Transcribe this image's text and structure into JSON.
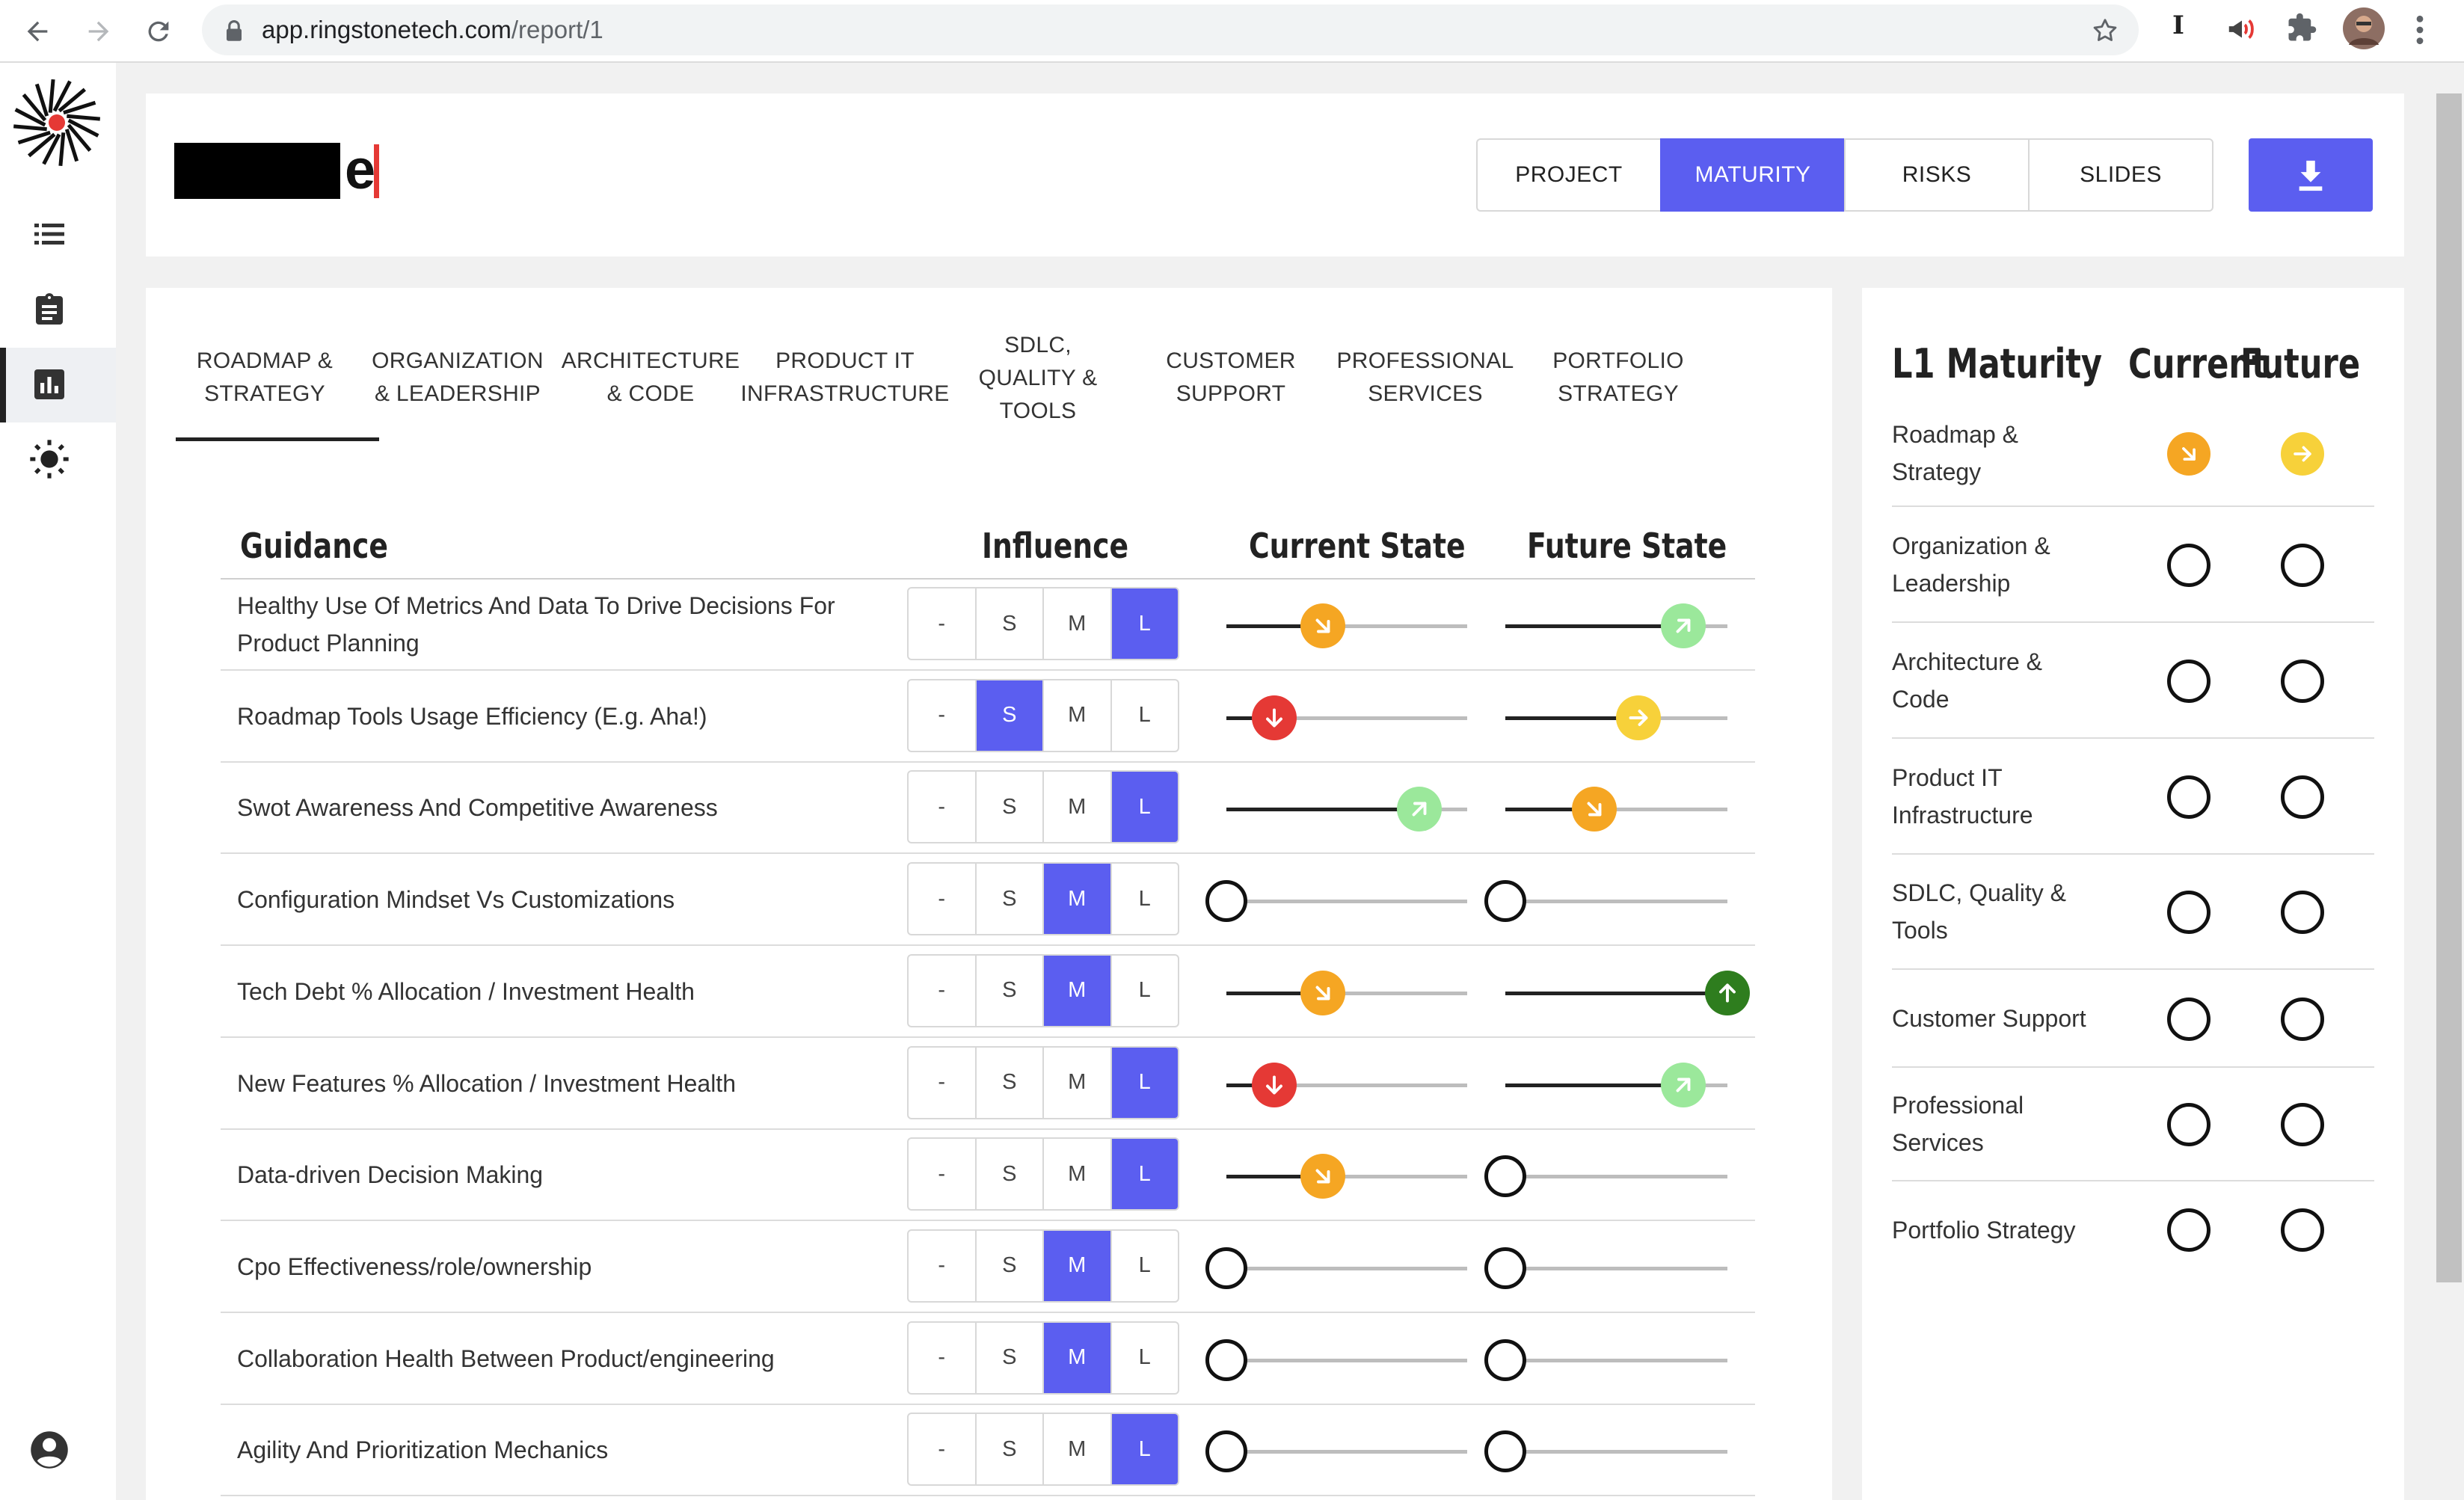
{
  "browser": {
    "url_domain": "app.ringstonetech.com",
    "url_path": "/report/1",
    "extension_letter": "I"
  },
  "header": {
    "brand_visible_text": "e",
    "tabs": [
      {
        "label": "PROJECT",
        "active": false
      },
      {
        "label": "MATURITY",
        "active": true
      },
      {
        "label": "RISKS",
        "active": false
      },
      {
        "label": "SLIDES",
        "active": false
      }
    ]
  },
  "categories": [
    {
      "line1": "ROADMAP &",
      "line2": "STRATEGY",
      "line3": "",
      "active": true
    },
    {
      "line1": "ORGANIZATION",
      "line2": "& LEADERSHIP",
      "line3": "",
      "active": false
    },
    {
      "line1": "ARCHITECTURE",
      "line2": "& CODE",
      "line3": "",
      "active": false
    },
    {
      "line1": "PRODUCT IT",
      "line2": "INFRASTRUCTURE",
      "line3": "",
      "active": false
    },
    {
      "line1": "SDLC,",
      "line2": "QUALITY &",
      "line3": "TOOLS",
      "active": false
    },
    {
      "line1": "CUSTOMER",
      "line2": "SUPPORT",
      "line3": "",
      "active": false
    },
    {
      "line1": "PROFESSIONAL",
      "line2": "SERVICES",
      "line3": "",
      "active": false
    },
    {
      "line1": "PORTFOLIO",
      "line2": "STRATEGY",
      "line3": "",
      "active": false
    }
  ],
  "table": {
    "headers": {
      "guidance": "Guidance",
      "influence": "Influence",
      "current": "Current State",
      "future": "Future State"
    },
    "influence_options": [
      "-",
      "S",
      "M",
      "L"
    ],
    "rows": [
      {
        "label": "Healthy Use Of Metrics And Data To Drive Decisions For Product Planning",
        "influence": "L",
        "current": {
          "level": 0.4,
          "status": "orange",
          "icon": "arrow-down-right-icon"
        },
        "future": {
          "level": 0.8,
          "status": "lightgreen",
          "icon": "arrow-up-right-icon"
        }
      },
      {
        "label": "Roadmap Tools Usage Efficiency (E.g. Aha!)",
        "influence": "S",
        "current": {
          "level": 0.2,
          "status": "red",
          "icon": "arrow-down-icon"
        },
        "future": {
          "level": 0.6,
          "status": "yellow",
          "icon": "arrow-right-icon"
        }
      },
      {
        "label": "Swot Awareness And Competitive Awareness",
        "influence": "L",
        "current": {
          "level": 0.8,
          "status": "lightgreen",
          "icon": "arrow-up-right-icon"
        },
        "future": {
          "level": 0.4,
          "status": "orange",
          "icon": "arrow-down-right-icon"
        }
      },
      {
        "label": "Configuration Mindset Vs Customizations",
        "influence": "M",
        "current": {
          "level": 0,
          "status": "none",
          "icon": ""
        },
        "future": {
          "level": 0,
          "status": "none",
          "icon": ""
        }
      },
      {
        "label": "Tech Debt % Allocation / Investment Health",
        "influence": "M",
        "current": {
          "level": 0.4,
          "status": "orange",
          "icon": "arrow-down-right-icon"
        },
        "future": {
          "level": 1.0,
          "status": "darkgreen",
          "icon": "arrow-up-icon"
        }
      },
      {
        "label": "New Features % Allocation / Investment Health",
        "influence": "L",
        "current": {
          "level": 0.2,
          "status": "red",
          "icon": "arrow-down-icon"
        },
        "future": {
          "level": 0.8,
          "status": "lightgreen",
          "icon": "arrow-up-right-icon"
        }
      },
      {
        "label": "Data-driven Decision Making",
        "influence": "L",
        "current": {
          "level": 0.4,
          "status": "orange",
          "icon": "arrow-down-right-icon"
        },
        "future": {
          "level": 0,
          "status": "none",
          "icon": ""
        }
      },
      {
        "label": "Cpo Effectiveness/role/ownership",
        "influence": "M",
        "current": {
          "level": 0,
          "status": "none",
          "icon": ""
        },
        "future": {
          "level": 0,
          "status": "none",
          "icon": ""
        }
      },
      {
        "label": "Collaboration Health Between Product/engineering",
        "influence": "M",
        "current": {
          "level": 0,
          "status": "none",
          "icon": ""
        },
        "future": {
          "level": 0,
          "status": "none",
          "icon": ""
        }
      },
      {
        "label": "Agility And Prioritization Mechanics",
        "influence": "L",
        "current": {
          "level": 0,
          "status": "none",
          "icon": ""
        },
        "future": {
          "level": 0,
          "status": "none",
          "icon": ""
        }
      }
    ]
  },
  "maturity": {
    "title": "L1 Maturity",
    "current_label": "Current",
    "future_label": "Future",
    "rows": [
      {
        "line1": "Roadmap &",
        "line2": "Strategy",
        "current": {
          "status": "orange",
          "icon": "arrow-down-right-icon"
        },
        "future": {
          "status": "yellow",
          "icon": "arrow-right-icon"
        }
      },
      {
        "line1": "Organization &",
        "line2": "Leadership",
        "current": {
          "status": "none",
          "icon": ""
        },
        "future": {
          "status": "none",
          "icon": ""
        }
      },
      {
        "line1": "Architecture &",
        "line2": "Code",
        "current": {
          "status": "none",
          "icon": ""
        },
        "future": {
          "status": "none",
          "icon": ""
        }
      },
      {
        "line1": "Product IT",
        "line2": "Infrastructure",
        "current": {
          "status": "none",
          "icon": ""
        },
        "future": {
          "status": "none",
          "icon": ""
        }
      },
      {
        "line1": "SDLC, Quality &",
        "line2": "Tools",
        "current": {
          "status": "none",
          "icon": ""
        },
        "future": {
          "status": "none",
          "icon": ""
        }
      },
      {
        "line1": "Customer Support",
        "line2": "",
        "current": {
          "status": "none",
          "icon": ""
        },
        "future": {
          "status": "none",
          "icon": ""
        }
      },
      {
        "line1": "Professional",
        "line2": "Services",
        "current": {
          "status": "none",
          "icon": ""
        },
        "future": {
          "status": "none",
          "icon": ""
        }
      },
      {
        "line1": "Portfolio Strategy",
        "line2": "",
        "current": {
          "status": "none",
          "icon": ""
        },
        "future": {
          "status": "none",
          "icon": ""
        }
      }
    ]
  },
  "colors": {
    "accent": "#5b5ef0",
    "orange": "#f5a623",
    "yellow": "#f7d13a",
    "lightgreen": "#9be89b",
    "darkgreen": "#2e7d1e",
    "red": "#e53935"
  },
  "sidebar_icons": [
    "logo-icon",
    "list-icon",
    "clipboard-icon",
    "bar-chart-icon",
    "sun-icon",
    "account-icon"
  ]
}
